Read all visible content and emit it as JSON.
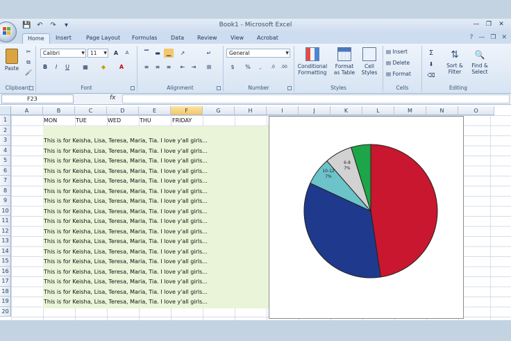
{
  "window": {
    "title": "Book1 - Microsoft Excel",
    "qat_icons": [
      "save-icon",
      "undo-icon",
      "redo-icon",
      "customize-icon"
    ],
    "controls": [
      "minimize-icon",
      "restore-icon",
      "close-icon"
    ]
  },
  "tabs": [
    "Home",
    "Insert",
    "Page Layout",
    "Formulas",
    "Data",
    "Review",
    "View",
    "Acrobat"
  ],
  "ribbon": {
    "clipboard": {
      "label": "Clipboard",
      "paste": "Paste"
    },
    "font": {
      "label": "Font",
      "name": "Calibri",
      "size": "11",
      "grow": "A",
      "shrink": "A",
      "bold": "B",
      "italic": "I",
      "underline": "U",
      "color": "A"
    },
    "alignment": {
      "label": "Alignment"
    },
    "number": {
      "label": "Number",
      "format": "General",
      "currency": "$",
      "percent": "%",
      "comma": ",",
      "inc_decimal": ".0",
      "dec_decimal": ".00"
    },
    "styles": {
      "label": "Styles",
      "conditional": "Conditional",
      "conditional2": "Formatting",
      "format_table": "Format",
      "format_table2": "as Table",
      "cell_styles": "Cell",
      "cell_styles2": "Styles"
    },
    "cells": {
      "label": "Cells",
      "insert": "Insert",
      "delete": "Delete",
      "format": "Format"
    },
    "editing": {
      "label": "Editing",
      "sort": "Sort &",
      "sort2": "Filter",
      "find": "Find &",
      "find2": "Select",
      "sum": "Σ"
    }
  },
  "formula_bar": {
    "name_box": "F23",
    "fx": "fx",
    "value": ""
  },
  "columns": [
    "A",
    "B",
    "C",
    "D",
    "E",
    "F",
    "G",
    "H",
    "I",
    "J",
    "K",
    "L",
    "M",
    "N",
    "O"
  ],
  "selected_column": "F",
  "rows": [
    "1",
    "2",
    "3",
    "4",
    "5",
    "6",
    "7",
    "8",
    "9",
    "10",
    "11",
    "12",
    "13",
    "14",
    "15",
    "16",
    "17",
    "18",
    "19",
    "20"
  ],
  "headers": {
    "b": "MON",
    "c": "TUE",
    "d": "WED",
    "e": "THU",
    "f": "FRIDAY"
  },
  "cell_text": [
    "This is for Keisha, Lisa, Teresa, Maria, Tia. I love y'all girls...",
    "This is for Keisha, Lisa, Teresa, Maria, Tia. I love y'all girls...",
    "This is for Keisha, Lisa, Teresa, Maria, Tia. I love y'all girls...",
    "This is for Keisha, Lisa, Teresa, Maria, Tia. I love y'all girls...",
    "This is for Keisha, Lisa, Teresa, Maria, Tia. I love y'all girls...",
    "This is for Keisha, Lisa, Teresa, Maria, Tia. I love y'all girls...",
    "This is for Keisha, Lisa, Teresa, Maria, Tia. I love y'all girls...",
    "This is for Keisha, Lisa, Teresa, Maria, Tia. I love y'all girls...",
    "This is for Keisha, Lisa, Teresa, Maria, Tia. I love y'all girls...",
    "This is for Keisha, Lisa, Teresa, Maria, Tia. I love y'all girls...",
    "This is for Keisha, Lisa, Teresa, Maria, Tia. I love y'all girls...",
    "This is for Keisha, Lisa, Teresa, Maria, Tia. I love y'all girls...",
    "This is for Keisha, Lisa, Teresa, Maria, Tia. I love y'all girls...",
    "This is for Keisha, Lisa, Teresa, Maria, Tia. I love y'all girls...",
    "This is for Keisha, Lisa, Teresa, Maria, Tia. I love y'all girls...",
    "This is for Keisha, Lisa, Teresa, Maria, Tia. I love y'all girls...",
    "This is for Keisha, Lisa, Teresa, Maria, Tia. I love y'all girls..."
  ],
  "chart_data": {
    "type": "pie",
    "values": [
      50,
      36,
      7,
      7
    ],
    "colors": [
      "#c8172e",
      "#1f3a8c",
      "#6cc3c9",
      "#d2d2d2"
    ],
    "extra_slice": {
      "value": 5,
      "color": "#1ea548"
    },
    "labels": [
      "",
      "",
      "10-12\n7%",
      "6-8\n7%"
    ]
  }
}
